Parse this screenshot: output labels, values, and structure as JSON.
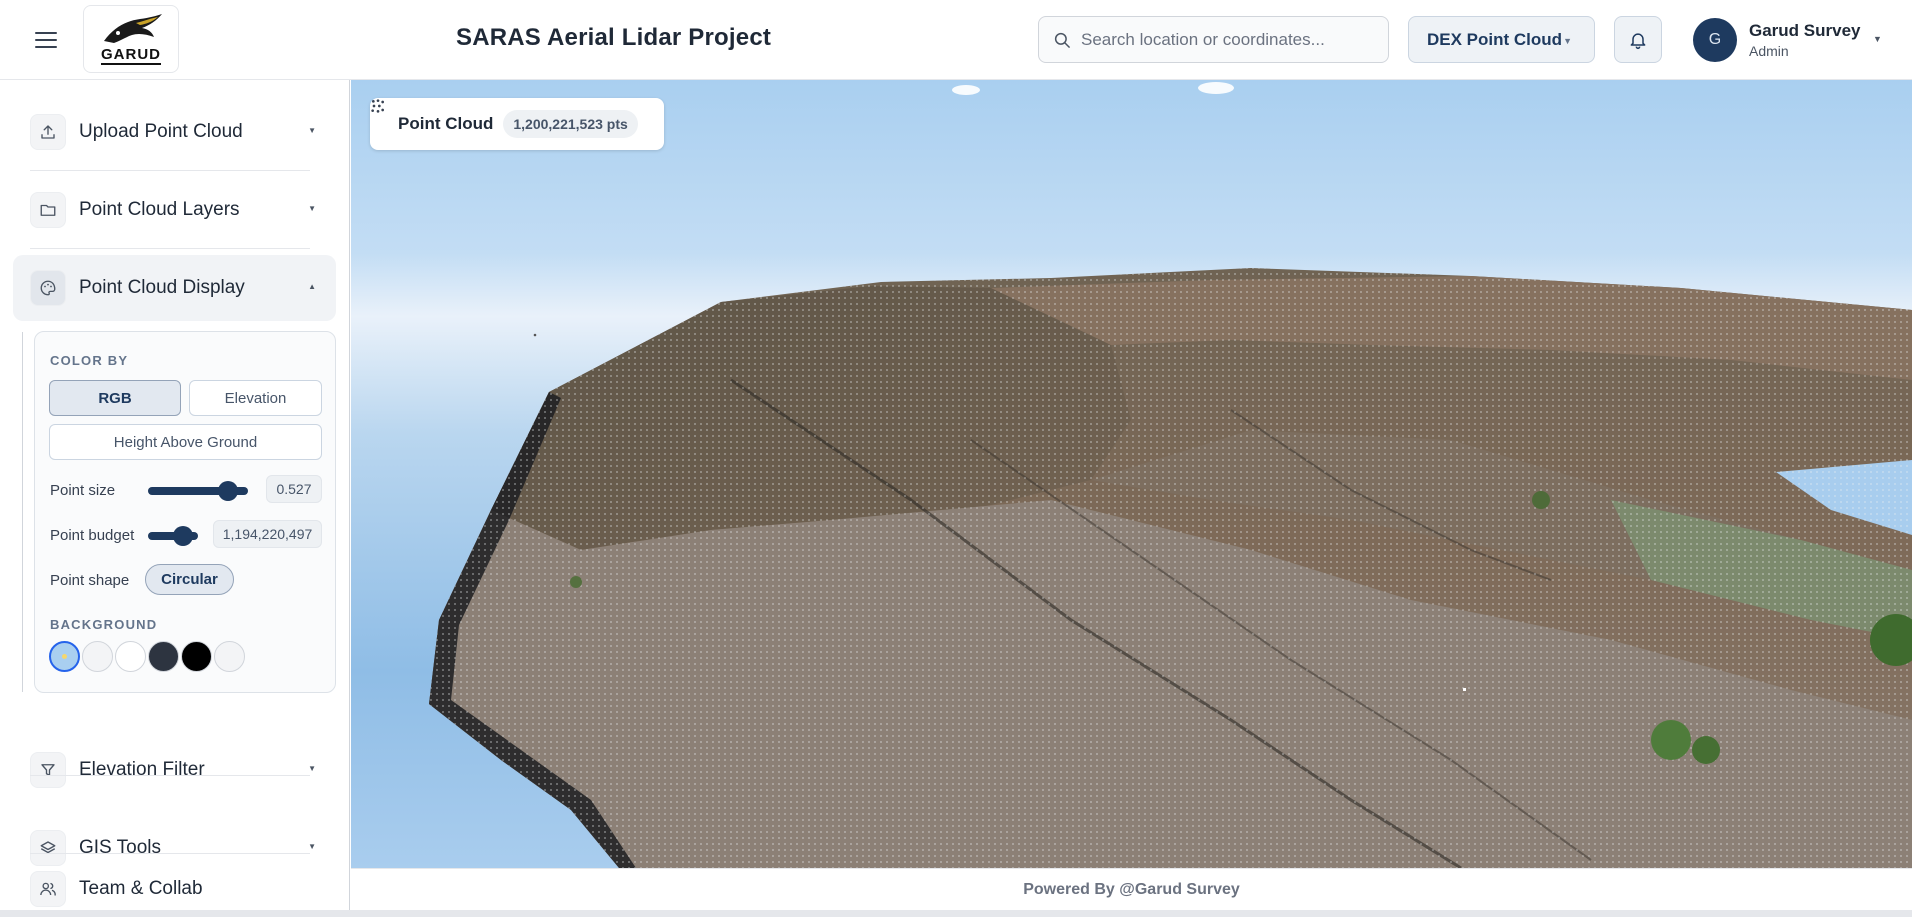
{
  "header": {
    "title": "SARAS Aerial Lidar Project",
    "logo_text": "GARUD",
    "search_placeholder": "Search location or coordinates...",
    "dataset_select": "DEX Point Cloud",
    "user": {
      "initial": "G",
      "name": "Garud Survey",
      "role": "Admin"
    }
  },
  "sidebar": {
    "items": [
      {
        "label": "Upload Point Cloud",
        "icon": "upload-icon"
      },
      {
        "label": "Point Cloud Layers",
        "icon": "folder-icon"
      },
      {
        "label": "Point Cloud Display",
        "icon": "palette-icon",
        "expanded": true
      },
      {
        "label": "Elevation Filter",
        "icon": "filter-icon"
      },
      {
        "label": "GIS Tools",
        "icon": "layers-icon"
      },
      {
        "label": "Team & Collab",
        "icon": "users-icon"
      }
    ],
    "display_panel": {
      "color_by_label": "COLOR BY",
      "color_options": [
        "RGB",
        "Elevation",
        "Height Above Ground"
      ],
      "selected_color": "RGB",
      "point_size_label": "Point size",
      "point_size_value": "0.527",
      "point_size_fraction": 0.8,
      "point_budget_label": "Point budget",
      "point_budget_value": "1,194,220,497",
      "point_budget_fraction": 0.7,
      "point_shape_label": "Point shape",
      "point_shape_value": "Circular",
      "background_label": "BACKGROUND",
      "background_swatches": [
        "#a9cff0",
        "#f3f4f6",
        "#ffffff",
        "#2d3440",
        "#000000",
        "#f3f4f6"
      ],
      "selected_background": 0
    }
  },
  "viewport": {
    "layer_label": "Point Cloud",
    "point_count": "1,200,221,523 pts"
  },
  "footer": {
    "text": "Powered By @Garud Survey"
  },
  "colors": {
    "accent": "#1e3a5f",
    "sky": "#a9cff0"
  }
}
